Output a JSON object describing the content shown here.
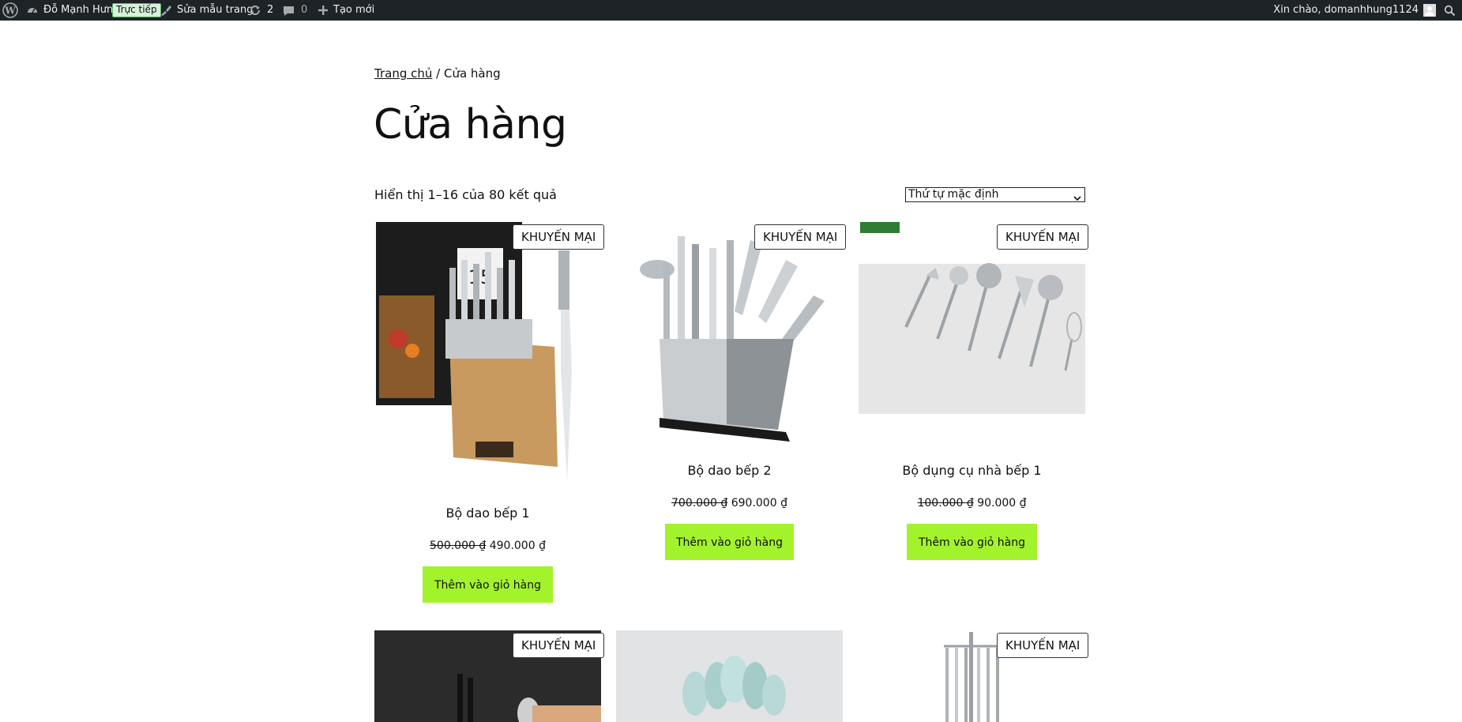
{
  "admin_bar": {
    "wp_logo_icon": "wordpress-logo-icon",
    "site_name": "Đỗ Mạnh Hưng",
    "live_badge": "Trực tiếp",
    "customize": "Sửa mẫu trang",
    "updates_count": "2",
    "comments_count": "0",
    "new_label": "Tạo mới",
    "greeting": "Xin chào, domanhhung1124",
    "search_icon": "search-icon"
  },
  "breadcrumb": {
    "home": "Trang chủ",
    "separator": " / ",
    "current": "Cửa hàng"
  },
  "page_title": "Cửa hàng",
  "result_count": "Hiển thị 1–16 của 80 kết quả",
  "sort": {
    "selected": "Thứ tự mặc định"
  },
  "colors": {
    "admin_bar": "#1d2327",
    "button": "#a3f32c"
  },
  "products": [
    {
      "badge": "KHUYẾN MẠI",
      "name": "Bộ dao bếp 1",
      "old_price": "500.000 ₫",
      "price": "490.000 ₫",
      "button": "Thêm vào giỏ hàng"
    },
    {
      "badge": "KHUYẾN MẠI",
      "name": "Bộ dao bếp 2",
      "old_price": "700.000 ₫",
      "price": "690.000 ₫",
      "button": "Thêm vào giỏ hàng"
    },
    {
      "badge": "KHUYẾN MẠI",
      "name": "Bộ dụng cụ nhà bếp 1",
      "old_price": "100.000 ₫",
      "price": "90.000 ₫",
      "button": "Thêm vào giỏ hàng"
    },
    {
      "badge": "KHUYẾN MẠI"
    },
    {},
    {
      "badge": "KHUYẾN MẠI"
    }
  ]
}
